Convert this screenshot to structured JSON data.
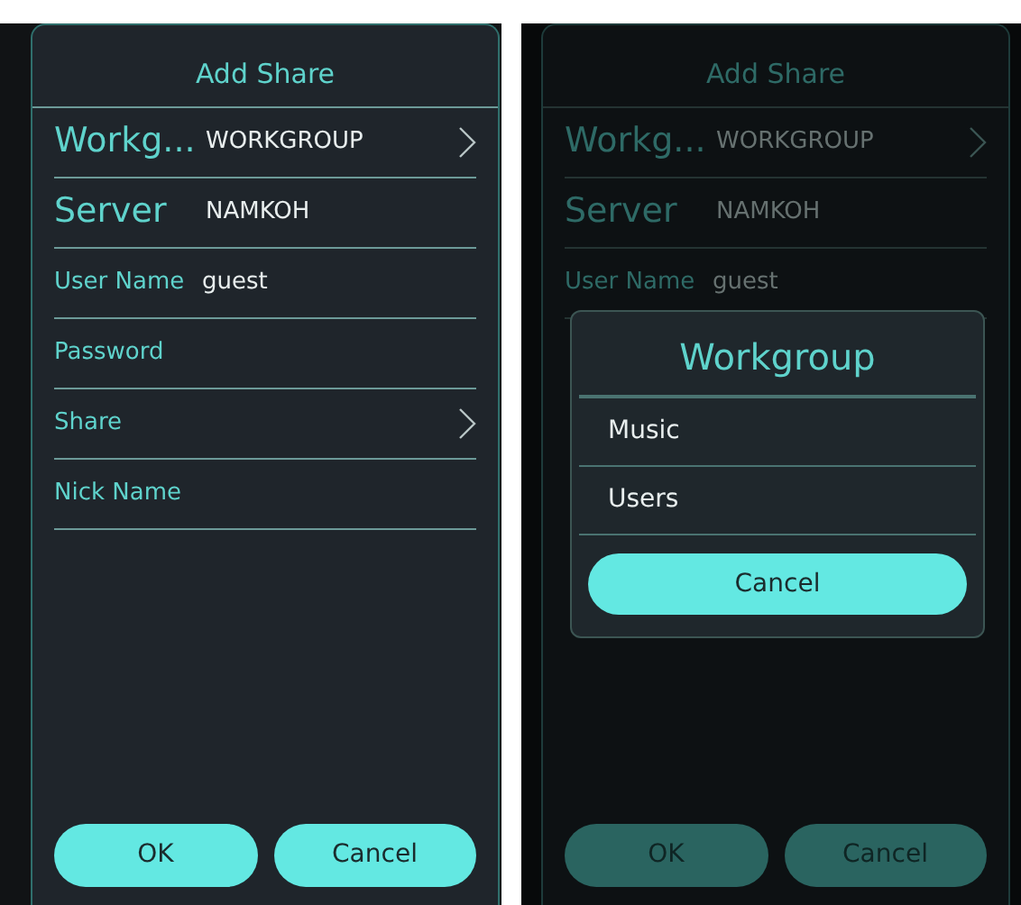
{
  "screens": [
    {
      "dimmed": false,
      "dialog": {
        "title": "Add Share",
        "rows": [
          {
            "kind": "picker",
            "label": "Workg...",
            "value": "WORKGROUP",
            "large": true
          },
          {
            "kind": "text",
            "label": "Server",
            "value": "NAMKOH",
            "large": true
          },
          {
            "kind": "text",
            "label": "User Name",
            "value": "guest",
            "large": false
          },
          {
            "kind": "text",
            "label": "Password",
            "large": false
          },
          {
            "kind": "picker",
            "label": "Share",
            "large": false
          },
          {
            "kind": "text",
            "label": "Nick Name",
            "large": false
          }
        ],
        "buttons": [
          "OK",
          "Cancel"
        ]
      }
    },
    {
      "dimmed": true,
      "dialog": {
        "title": "Add Share",
        "rows": [
          {
            "kind": "picker",
            "label": "Workg...",
            "value": "WORKGROUP",
            "large": true
          },
          {
            "kind": "text",
            "label": "Server",
            "value": "NAMKOH",
            "large": true
          },
          {
            "kind": "text",
            "label": "User Name",
            "value": "guest",
            "large": false
          }
        ],
        "buttons": [
          "OK",
          "Cancel"
        ]
      },
      "popup": {
        "title": "Workgroup",
        "items": [
          "Music",
          "Users"
        ],
        "cancel": "Cancel"
      }
    }
  ]
}
